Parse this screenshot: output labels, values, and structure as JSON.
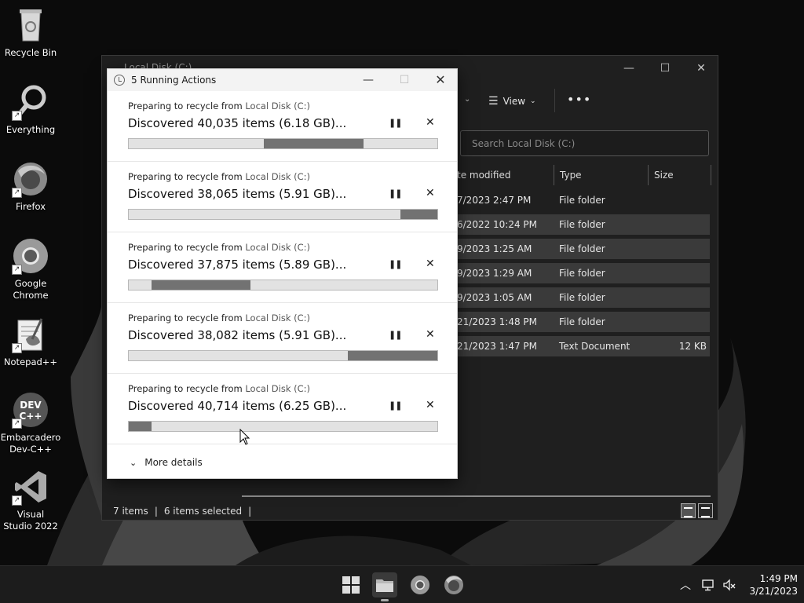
{
  "desktop": {
    "icons": [
      {
        "name": "Recycle Bin"
      },
      {
        "name": "Everything"
      },
      {
        "name": "Firefox"
      },
      {
        "name": "Google Chrome"
      },
      {
        "name": "Notepad++"
      },
      {
        "name": "Embarcadero Dev-C++"
      },
      {
        "name": "Visual Studio 2022"
      }
    ]
  },
  "explorer": {
    "title": "Local Disk (C:)",
    "toolbar": {
      "view_label": "View",
      "more_label": "•••"
    },
    "search_placeholder": "Search Local Disk (C:)",
    "columns": [
      "te modified",
      "Type",
      "Size"
    ],
    "rows": [
      {
        "date": "7/2023 2:47 PM",
        "type": "File folder",
        "size": "",
        "selected": false
      },
      {
        "date": "6/2022 10:24 PM",
        "type": "File folder",
        "size": "",
        "selected": true
      },
      {
        "date": "9/2023 1:25 AM",
        "type": "File folder",
        "size": "",
        "selected": true
      },
      {
        "date": "9/2023 1:29 AM",
        "type": "File folder",
        "size": "",
        "selected": true
      },
      {
        "date": "9/2023 1:05 AM",
        "type": "File folder",
        "size": "",
        "selected": true
      },
      {
        "date": "21/2023 1:48 PM",
        "type": "File folder",
        "size": "",
        "selected": true
      },
      {
        "date": "21/2023 1:47 PM",
        "type": "Text Document",
        "size": "12 KB",
        "selected": true
      }
    ],
    "status": {
      "items": "7 items",
      "selected": "6 items selected"
    }
  },
  "dialog": {
    "title": "5 Running Actions",
    "operations": [
      {
        "prefix": "Preparing to recycle from ",
        "location": "Local Disk (C:)",
        "main": "Discovered 40,035 items (6.18 GB)...",
        "progress_start": 0.437,
        "progress_end": 0.76
      },
      {
        "prefix": "Preparing to recycle from ",
        "location": "Local Disk (C:)",
        "main": "Discovered 38,065 items (5.91 GB)...",
        "progress_start": 0.88,
        "progress_end": 1.0
      },
      {
        "prefix": "Preparing to recycle from ",
        "location": "Local Disk (C:)",
        "main": "Discovered 37,875 items (5.89 GB)...",
        "progress_start": 0.073,
        "progress_end": 0.395
      },
      {
        "prefix": "Preparing to recycle from ",
        "location": "Local Disk (C:)",
        "main": "Discovered 38,082 items (5.91 GB)...",
        "progress_start": 0.71,
        "progress_end": 1.0
      },
      {
        "prefix": "Preparing to recycle from ",
        "location": "Local Disk (C:)",
        "main": "Discovered 40,714 items (6.25 GB)...",
        "progress_start": 0.0,
        "progress_end": 0.075
      }
    ],
    "more_details_label": "More details"
  },
  "taskbar": {
    "clock_time": "1:49 PM",
    "clock_date": "3/21/2023"
  }
}
